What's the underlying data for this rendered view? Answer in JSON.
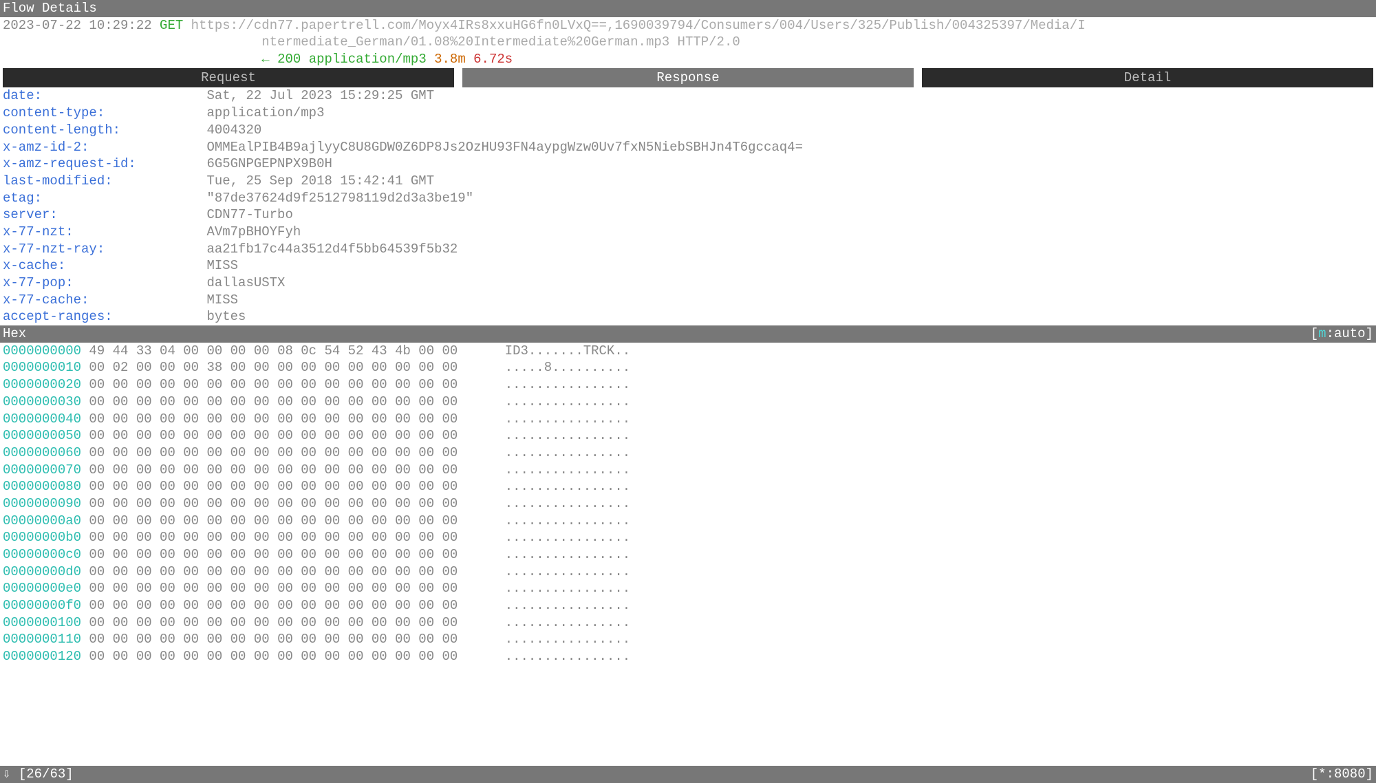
{
  "title_bar": "Flow Details",
  "flow": {
    "timestamp": "2023-07-22 10:29:22",
    "method": "GET",
    "url_line1": "https://cdn77.papertrell.com/Moyx4IRs8xxuHG6fn0LVxQ==,1690039794/Consumers/004/Users/325/Publish/004325397/Media/I",
    "url_line2": "ntermediate_German/01.08%20Intermediate%20German.mp3 HTTP/2.0",
    "arrow": "←",
    "status": "200",
    "content_type": "application/mp3",
    "size": "3.8m",
    "time": "6.72s"
  },
  "tabs": {
    "request": "Request",
    "response": "Response",
    "detail": "Detail"
  },
  "headers": [
    {
      "key": "date:",
      "val": "Sat, 22 Jul 2023 15:29:25 GMT"
    },
    {
      "key": "content-type:",
      "val": "application/mp3"
    },
    {
      "key": "content-length:",
      "val": "4004320"
    },
    {
      "key": "x-amz-id-2:",
      "val": "OMMEalPIB4B9ajlyyC8U8GDW0Z6DP8Js2OzHU93FN4aypgWzw0Uv7fxN5NiebSBHJn4T6gccaq4="
    },
    {
      "key": "x-amz-request-id:",
      "val": "6G5GNPGEPNPX9B0H"
    },
    {
      "key": "last-modified:",
      "val": "Tue, 25 Sep 2018 15:42:41 GMT"
    },
    {
      "key": "etag:",
      "val": "\"87de37624d9f2512798119d2d3a3be19\""
    },
    {
      "key": "server:",
      "val": "CDN77-Turbo"
    },
    {
      "key": "x-77-nzt:",
      "val": "AVm7pBHOYFyh"
    },
    {
      "key": "x-77-nzt-ray:",
      "val": "aa21fb17c44a3512d4f5bb64539f5b32"
    },
    {
      "key": "x-cache:",
      "val": "MISS"
    },
    {
      "key": "x-77-pop:",
      "val": "dallasUSTX"
    },
    {
      "key": "x-77-cache:",
      "val": "MISS"
    },
    {
      "key": "accept-ranges:",
      "val": "bytes"
    }
  ],
  "hex_bar": {
    "label": "Hex",
    "mode_prefix": "[",
    "mode_m": "m",
    "mode_rest": ":auto]"
  },
  "hex": [
    {
      "offset": "0000000000",
      "bytes": "49 44 33 04 00 00 00 00 08 0c 54 52 43 4b 00 00",
      "ascii": "ID3.......TRCK.."
    },
    {
      "offset": "0000000010",
      "bytes": "00 02 00 00 00 38 00 00 00 00 00 00 00 00 00 00",
      "ascii": ".....8.........."
    },
    {
      "offset": "0000000020",
      "bytes": "00 00 00 00 00 00 00 00 00 00 00 00 00 00 00 00",
      "ascii": "................"
    },
    {
      "offset": "0000000030",
      "bytes": "00 00 00 00 00 00 00 00 00 00 00 00 00 00 00 00",
      "ascii": "................"
    },
    {
      "offset": "0000000040",
      "bytes": "00 00 00 00 00 00 00 00 00 00 00 00 00 00 00 00",
      "ascii": "................"
    },
    {
      "offset": "0000000050",
      "bytes": "00 00 00 00 00 00 00 00 00 00 00 00 00 00 00 00",
      "ascii": "................"
    },
    {
      "offset": "0000000060",
      "bytes": "00 00 00 00 00 00 00 00 00 00 00 00 00 00 00 00",
      "ascii": "................"
    },
    {
      "offset": "0000000070",
      "bytes": "00 00 00 00 00 00 00 00 00 00 00 00 00 00 00 00",
      "ascii": "................"
    },
    {
      "offset": "0000000080",
      "bytes": "00 00 00 00 00 00 00 00 00 00 00 00 00 00 00 00",
      "ascii": "................"
    },
    {
      "offset": "0000000090",
      "bytes": "00 00 00 00 00 00 00 00 00 00 00 00 00 00 00 00",
      "ascii": "................"
    },
    {
      "offset": "00000000a0",
      "bytes": "00 00 00 00 00 00 00 00 00 00 00 00 00 00 00 00",
      "ascii": "................"
    },
    {
      "offset": "00000000b0",
      "bytes": "00 00 00 00 00 00 00 00 00 00 00 00 00 00 00 00",
      "ascii": "................"
    },
    {
      "offset": "00000000c0",
      "bytes": "00 00 00 00 00 00 00 00 00 00 00 00 00 00 00 00",
      "ascii": "................"
    },
    {
      "offset": "00000000d0",
      "bytes": "00 00 00 00 00 00 00 00 00 00 00 00 00 00 00 00",
      "ascii": "................"
    },
    {
      "offset": "00000000e0",
      "bytes": "00 00 00 00 00 00 00 00 00 00 00 00 00 00 00 00",
      "ascii": "................"
    },
    {
      "offset": "00000000f0",
      "bytes": "00 00 00 00 00 00 00 00 00 00 00 00 00 00 00 00",
      "ascii": "................"
    },
    {
      "offset": "0000000100",
      "bytes": "00 00 00 00 00 00 00 00 00 00 00 00 00 00 00 00",
      "ascii": "................"
    },
    {
      "offset": "0000000110",
      "bytes": "00 00 00 00 00 00 00 00 00 00 00 00 00 00 00 00",
      "ascii": "................"
    },
    {
      "offset": "0000000120",
      "bytes": "00 00 00 00 00 00 00 00 00 00 00 00 00 00 00 00",
      "ascii": "................"
    }
  ],
  "status_bar": {
    "arrow": "⇩",
    "position": "[26/63]",
    "listen": "[*:8080]"
  }
}
